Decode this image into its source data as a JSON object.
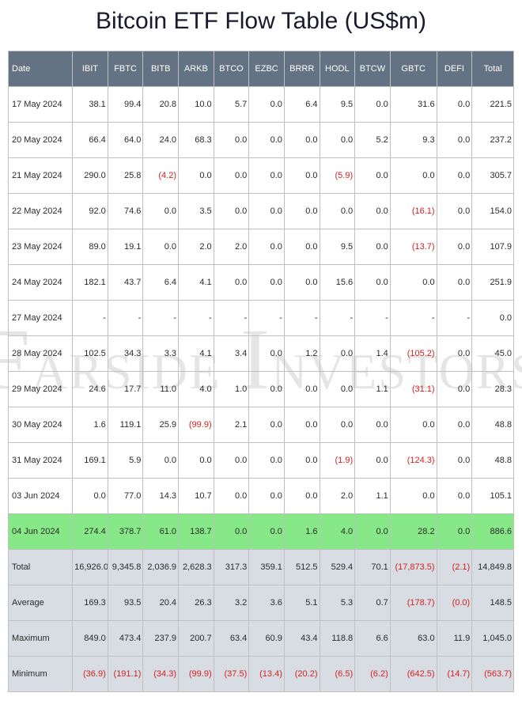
{
  "title": "Bitcoin ETF Flow Table (US$m)",
  "watermark": "Farside Investors",
  "columns": [
    "Date",
    "IBIT",
    "FBTC",
    "BITB",
    "ARKB",
    "BTCO",
    "EZBC",
    "BRRR",
    "HODL",
    "BTCW",
    "GBTC",
    "DEFI",
    "Total"
  ],
  "rows": [
    {
      "date": "17 May 2024",
      "cells": [
        "38.1",
        "99.4",
        "20.8",
        "10.0",
        "5.7",
        "0.0",
        "6.4",
        "9.5",
        "0.0",
        "31.6",
        "0.0",
        "221.5"
      ]
    },
    {
      "date": "20 May 2024",
      "cells": [
        "66.4",
        "64.0",
        "24.0",
        "68.3",
        "0.0",
        "0.0",
        "0.0",
        "0.0",
        "5.2",
        "9.3",
        "0.0",
        "237.2"
      ]
    },
    {
      "date": "21 May 2024",
      "cells": [
        "290.0",
        "25.8",
        "(4.2)",
        "0.0",
        "0.0",
        "0.0",
        "0.0",
        "(5.9)",
        "0.0",
        "0.0",
        "0.0",
        "305.7"
      ]
    },
    {
      "date": "22 May 2024",
      "cells": [
        "92.0",
        "74.6",
        "0.0",
        "3.5",
        "0.0",
        "0.0",
        "0.0",
        "0.0",
        "0.0",
        "(16.1)",
        "0.0",
        "154.0"
      ]
    },
    {
      "date": "23 May 2024",
      "cells": [
        "89.0",
        "19.1",
        "0.0",
        "2.0",
        "2.0",
        "0.0",
        "0.0",
        "9.5",
        "0.0",
        "(13.7)",
        "0.0",
        "107.9"
      ]
    },
    {
      "date": "24 May 2024",
      "cells": [
        "182.1",
        "43.7",
        "6.4",
        "4.1",
        "0.0",
        "0.0",
        "0.0",
        "15.6",
        "0.0",
        "0.0",
        "0.0",
        "251.9"
      ]
    },
    {
      "date": "27 May 2024",
      "cells": [
        "-",
        "-",
        "-",
        "-",
        "-",
        "-",
        "-",
        "-",
        "-",
        "-",
        "-",
        "0.0"
      ]
    },
    {
      "date": "28 May 2024",
      "cells": [
        "102.5",
        "34.3",
        "3.3",
        "4.1",
        "3.4",
        "0.0",
        "1.2",
        "0.0",
        "1.4",
        "(105.2)",
        "0.0",
        "45.0"
      ]
    },
    {
      "date": "29 May 2024",
      "cells": [
        "24.6",
        "17.7",
        "11.0",
        "4.0",
        "1.0",
        "0.0",
        "0.0",
        "0.0",
        "1.1",
        "(31.1)",
        "0.0",
        "28.3"
      ]
    },
    {
      "date": "30 May 2024",
      "cells": [
        "1.6",
        "119.1",
        "25.9",
        "(99.9)",
        "2.1",
        "0.0",
        "0.0",
        "0.0",
        "0.0",
        "0.0",
        "0.0",
        "48.8"
      ]
    },
    {
      "date": "31 May 2024",
      "cells": [
        "169.1",
        "5.9",
        "0.0",
        "0.0",
        "0.0",
        "0.0",
        "0.0",
        "(1.9)",
        "0.0",
        "(124.3)",
        "0.0",
        "48.8"
      ]
    },
    {
      "date": "03 Jun 2024",
      "cells": [
        "0.0",
        "77.0",
        "14.3",
        "10.7",
        "0.0",
        "0.0",
        "0.0",
        "2.0",
        "1.1",
        "0.0",
        "0.0",
        "105.1"
      ]
    },
    {
      "date": "04 Jun 2024",
      "cells": [
        "274.4",
        "378.7",
        "61.0",
        "138.7",
        "0.0",
        "0.0",
        "1.6",
        "4.0",
        "0.0",
        "28.2",
        "0.0",
        "886.6"
      ],
      "highlight": true
    }
  ],
  "summary": [
    {
      "label": "Total",
      "cells": [
        "16,926.0",
        "9,345.8",
        "2,036.9",
        "2,628.3",
        "317.3",
        "359.1",
        "512.5",
        "529.4",
        "70.1",
        "(17,873.5)",
        "(2.1)",
        "14,849.8"
      ]
    },
    {
      "label": "Average",
      "cells": [
        "169.3",
        "93.5",
        "20.4",
        "26.3",
        "3.2",
        "3.6",
        "5.1",
        "5.3",
        "0.7",
        "(178.7)",
        "(0.0)",
        "148.5"
      ]
    },
    {
      "label": "Maximum",
      "cells": [
        "849.0",
        "473.4",
        "237.9",
        "200.7",
        "63.4",
        "60.9",
        "43.4",
        "118.8",
        "6.6",
        "63.0",
        "11.9",
        "1,045.0"
      ]
    },
    {
      "label": "Minimum",
      "cells": [
        "(36.9)",
        "(191.1)",
        "(34.3)",
        "(99.9)",
        "(37.5)",
        "(13.4)",
        "(20.2)",
        "(6.5)",
        "(6.2)",
        "(642.5)",
        "(14.7)",
        "(563.7)"
      ]
    }
  ],
  "chart_data": {
    "type": "table",
    "title": "Bitcoin ETF Flow Table (US$m)",
    "columns": [
      "Date",
      "IBIT",
      "FBTC",
      "BITB",
      "ARKB",
      "BTCO",
      "EZBC",
      "BRRR",
      "HODL",
      "BTCW",
      "GBTC",
      "DEFI",
      "Total"
    ],
    "data": [
      [
        "17 May 2024",
        38.1,
        99.4,
        20.8,
        10.0,
        5.7,
        0.0,
        6.4,
        9.5,
        0.0,
        31.6,
        0.0,
        221.5
      ],
      [
        "20 May 2024",
        66.4,
        64.0,
        24.0,
        68.3,
        0.0,
        0.0,
        0.0,
        0.0,
        5.2,
        9.3,
        0.0,
        237.2
      ],
      [
        "21 May 2024",
        290.0,
        25.8,
        -4.2,
        0.0,
        0.0,
        0.0,
        0.0,
        -5.9,
        0.0,
        0.0,
        0.0,
        305.7
      ],
      [
        "22 May 2024",
        92.0,
        74.6,
        0.0,
        3.5,
        0.0,
        0.0,
        0.0,
        0.0,
        0.0,
        -16.1,
        0.0,
        154.0
      ],
      [
        "23 May 2024",
        89.0,
        19.1,
        0.0,
        2.0,
        2.0,
        0.0,
        0.0,
        9.5,
        0.0,
        -13.7,
        0.0,
        107.9
      ],
      [
        "24 May 2024",
        182.1,
        43.7,
        6.4,
        4.1,
        0.0,
        0.0,
        0.0,
        15.6,
        0.0,
        0.0,
        0.0,
        251.9
      ],
      [
        "27 May 2024",
        null,
        null,
        null,
        null,
        null,
        null,
        null,
        null,
        null,
        null,
        null,
        0.0
      ],
      [
        "28 May 2024",
        102.5,
        34.3,
        3.3,
        4.1,
        3.4,
        0.0,
        1.2,
        0.0,
        1.4,
        -105.2,
        0.0,
        45.0
      ],
      [
        "29 May 2024",
        24.6,
        17.7,
        11.0,
        4.0,
        1.0,
        0.0,
        0.0,
        0.0,
        1.1,
        -31.1,
        0.0,
        28.3
      ],
      [
        "30 May 2024",
        1.6,
        119.1,
        25.9,
        -99.9,
        2.1,
        0.0,
        0.0,
        0.0,
        0.0,
        0.0,
        0.0,
        48.8
      ],
      [
        "31 May 2024",
        169.1,
        5.9,
        0.0,
        0.0,
        0.0,
        0.0,
        0.0,
        -1.9,
        0.0,
        -124.3,
        0.0,
        48.8
      ],
      [
        "03 Jun 2024",
        0.0,
        77.0,
        14.3,
        10.7,
        0.0,
        0.0,
        0.0,
        2.0,
        1.1,
        0.0,
        0.0,
        105.1
      ],
      [
        "04 Jun 2024",
        274.4,
        378.7,
        61.0,
        138.7,
        0.0,
        0.0,
        1.6,
        4.0,
        0.0,
        28.2,
        0.0,
        886.6
      ]
    ],
    "summary": {
      "Total": [
        16926.0,
        9345.8,
        2036.9,
        2628.3,
        317.3,
        359.1,
        512.5,
        529.4,
        70.1,
        -17873.5,
        -2.1,
        14849.8
      ],
      "Average": [
        169.3,
        93.5,
        20.4,
        26.3,
        3.2,
        3.6,
        5.1,
        5.3,
        0.7,
        -178.7,
        -0.0,
        148.5
      ],
      "Maximum": [
        849.0,
        473.4,
        237.9,
        200.7,
        63.4,
        60.9,
        43.4,
        118.8,
        6.6,
        63.0,
        11.9,
        1045.0
      ],
      "Minimum": [
        -36.9,
        -191.1,
        -34.3,
        -99.9,
        -37.5,
        -13.4,
        -20.2,
        -6.5,
        -6.2,
        -642.5,
        -14.7,
        -563.7
      ]
    }
  }
}
